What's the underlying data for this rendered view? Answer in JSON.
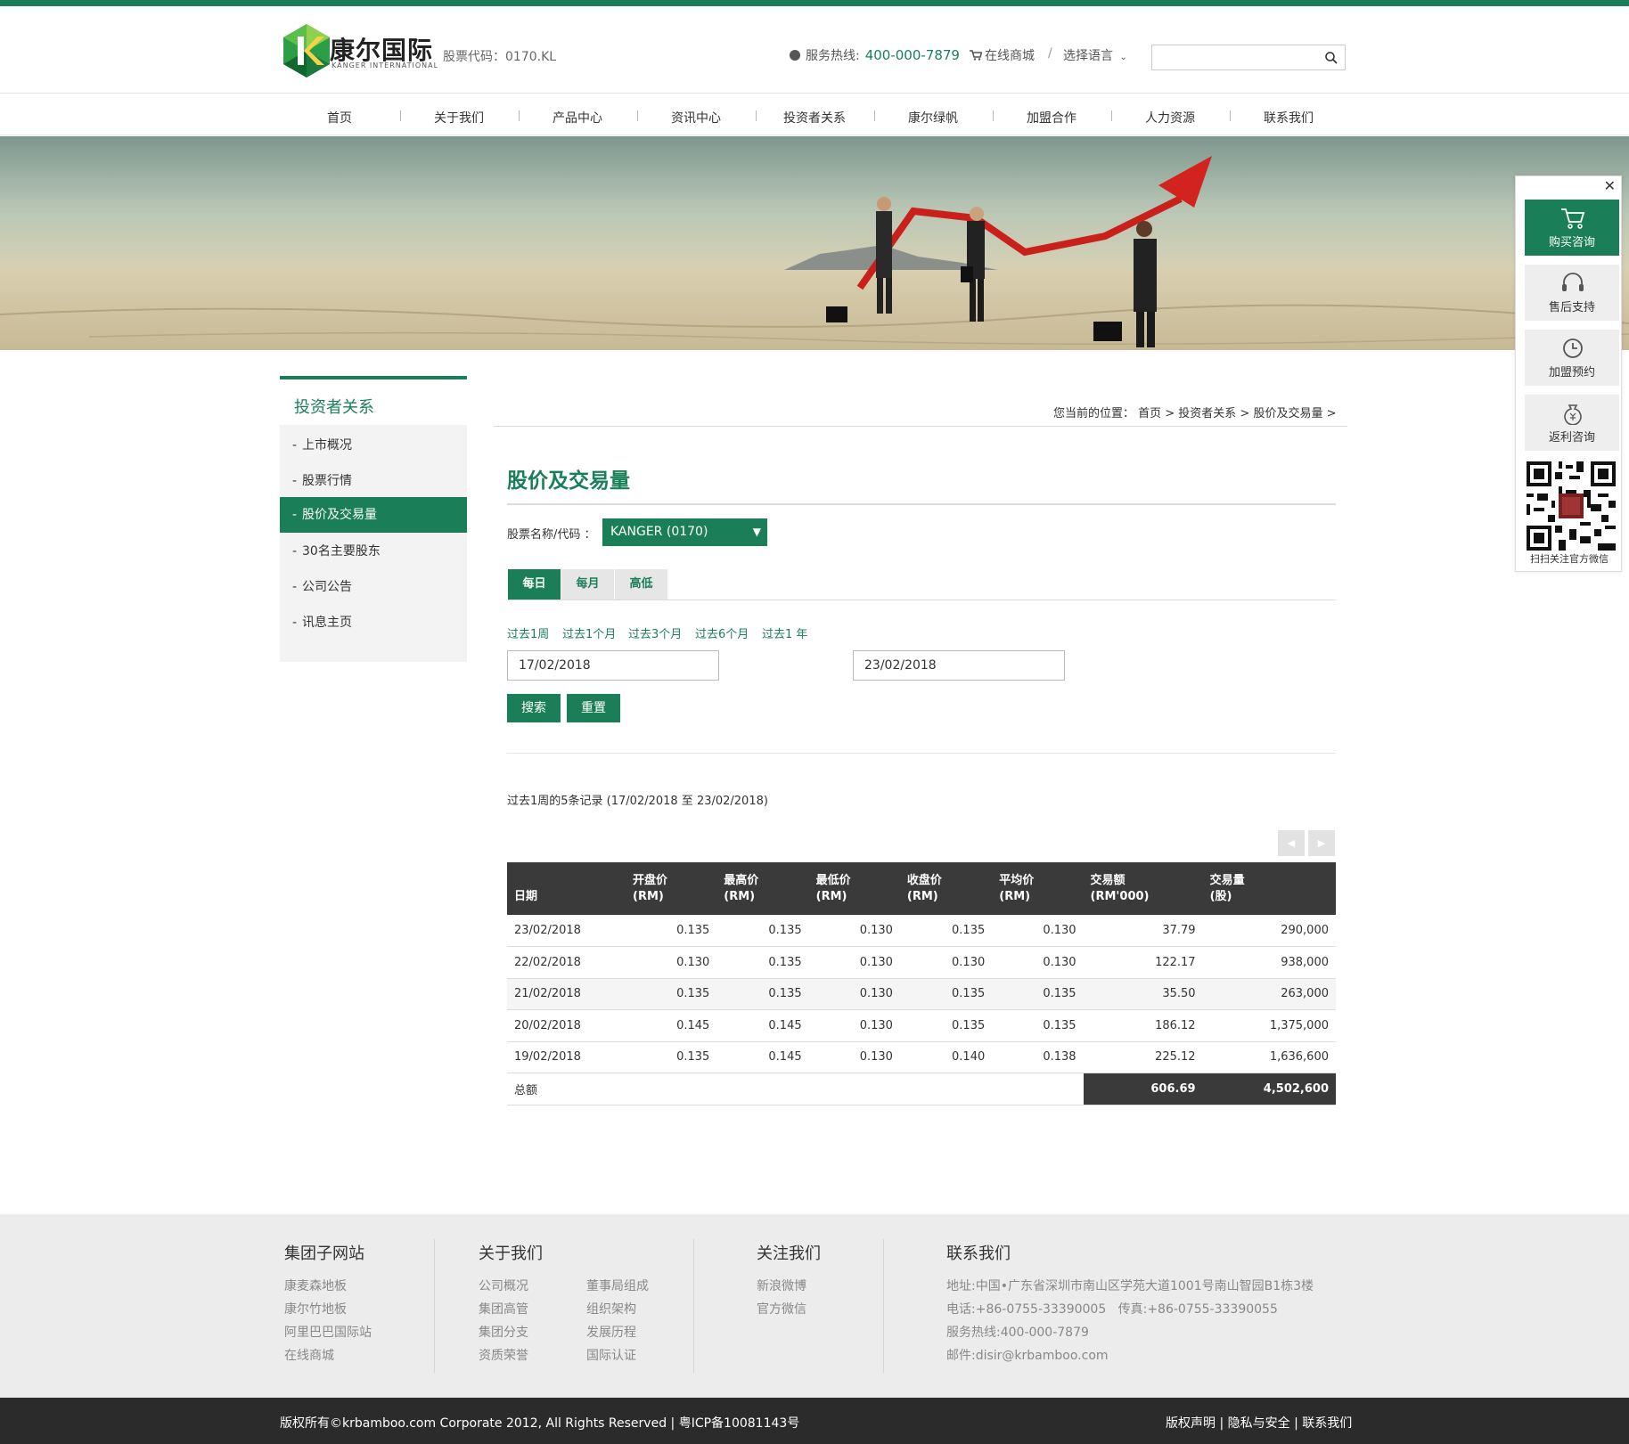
{
  "header": {
    "logo_cn": "康尔国际",
    "logo_en": "KANGER INTERNATIONAL",
    "stock_code": "股票代码：0170.KL",
    "hotline_label": "服务热线:",
    "hotline_number": "400-000-7879",
    "shop_label": "在线商城",
    "separator": "/",
    "language_label": "选择语言",
    "search_placeholder": ""
  },
  "nav": [
    "首页",
    "关于我们",
    "产品中心",
    "资讯中心",
    "投资者关系",
    "康尔绿帆",
    "加盟合作",
    "人力资源",
    "联系我们"
  ],
  "sidebar": {
    "title": "投资者关系",
    "items": [
      {
        "label": "上市概况",
        "active": false
      },
      {
        "label": "股票行情",
        "active": false
      },
      {
        "label": "股价及交易量",
        "active": true
      },
      {
        "label": "30名主要股东",
        "active": false
      },
      {
        "label": "公司公告",
        "active": false
      },
      {
        "label": "讯息主页",
        "active": false
      }
    ]
  },
  "breadcrumb": "您当前的位置： 首页 > 投资者关系 > 股价及交易量 >",
  "main": {
    "title": "股价及交易量",
    "select_label": "股票名称/代码 ：",
    "select_value": "KANGER (0170)",
    "tabs": [
      "每日",
      "每月",
      "高低"
    ],
    "ranges": [
      "过去1周",
      "过去1个月",
      "过去3个月",
      "过去6个月",
      "过去1 年"
    ],
    "date_from": "17/02/2018",
    "date_to": "23/02/2018",
    "search_button": "搜索",
    "reset_button": "重置",
    "record_info": "过去1周的5条记录 (17/02/2018 至 23/02/2018)",
    "pager_prev": "◀",
    "pager_next": "▶"
  },
  "table": {
    "headers": [
      [
        "日期"
      ],
      [
        "开盘价",
        "(RM)"
      ],
      [
        "最高价",
        "(RM)"
      ],
      [
        "最低价",
        "(RM)"
      ],
      [
        "收盘价",
        "(RM)"
      ],
      [
        "平均价",
        "(RM)"
      ],
      [
        "交易额",
        "(RM'000)"
      ],
      [
        "交易量",
        "(股)"
      ]
    ],
    "rows": [
      [
        "23/02/2018",
        "0.135",
        "0.135",
        "0.130",
        "0.135",
        "0.130",
        "37.79",
        "290,000"
      ],
      [
        "22/02/2018",
        "0.130",
        "0.135",
        "0.130",
        "0.130",
        "0.130",
        "122.17",
        "938,000"
      ],
      [
        "21/02/2018",
        "0.135",
        "0.135",
        "0.130",
        "0.135",
        "0.135",
        "35.50",
        "263,000"
      ],
      [
        "20/02/2018",
        "0.145",
        "0.145",
        "0.130",
        "0.135",
        "0.135",
        "186.12",
        "1,375,000"
      ],
      [
        "19/02/2018",
        "0.135",
        "0.145",
        "0.130",
        "0.140",
        "0.138",
        "225.12",
        "1,636,600"
      ]
    ],
    "total_label": "总额",
    "total_amount": "606.69",
    "total_volume": "4,502,600"
  },
  "footer": {
    "col1": {
      "title": "集团子网站",
      "links": [
        "康麦森地板",
        "康尔竹地板",
        "阿里巴巴国际站",
        "在线商城"
      ]
    },
    "col2": {
      "title": "关于我们",
      "links_a": [
        "公司概况",
        "集团高管",
        "集团分支",
        "资质荣誉"
      ],
      "links_b": [
        "董事局组成",
        "组织架构",
        "发展历程",
        "国际认证"
      ]
    },
    "col3": {
      "title": "关注我们",
      "links": [
        "新浪微博",
        "官方微信"
      ]
    },
    "col4": {
      "title": "联系我们",
      "lines": [
        "地址:中国•广东省深圳市南山区学苑大道1001号南山智园B1栋3楼",
        "电话:+86-0755-33390005   传真:+86-0755-33390055",
        "服务热线:400-000-7879",
        "邮件:disir@krbamboo.com"
      ]
    },
    "copyright": "版权所有©krbamboo.com Corporate 2012, All Rights Reserved | 粤ICP备10081143号",
    "right_links": "版权声明 | 隐私与安全 | 联系我们"
  },
  "float_panel": {
    "close": "✕",
    "items": [
      "购买咨询",
      "售后支持",
      "加盟预约",
      "返利咨询"
    ],
    "qr_text": "扫扫关注官方微信"
  },
  "colors": {
    "brand": "#1a7f58",
    "dark": "#3a3a3a",
    "footer_bg": "#ececec",
    "copy_bg": "#2b2b2b"
  }
}
